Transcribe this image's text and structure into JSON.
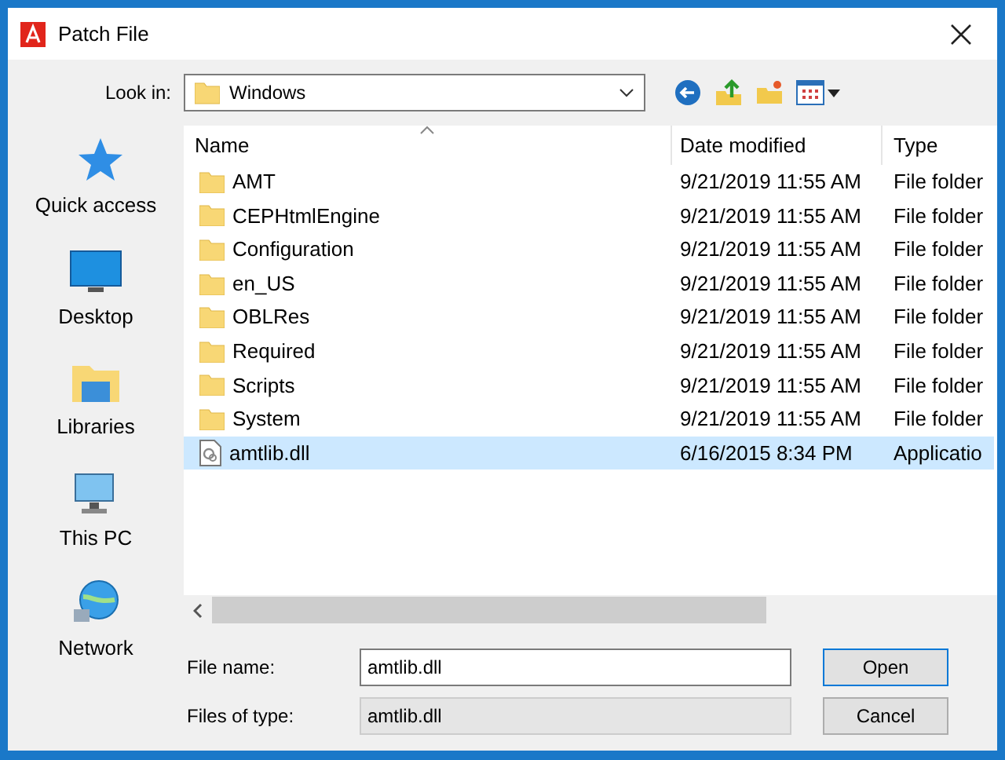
{
  "window": {
    "title": "Patch File"
  },
  "look_in": {
    "label": "Look in:",
    "value": "Windows"
  },
  "places": [
    {
      "kind": "quick",
      "label": "Quick access"
    },
    {
      "kind": "desktop",
      "label": "Desktop"
    },
    {
      "kind": "libraries",
      "label": "Libraries"
    },
    {
      "kind": "pc",
      "label": "This PC"
    },
    {
      "kind": "network",
      "label": "Network"
    }
  ],
  "table": {
    "columns": [
      "Name",
      "Date modified",
      "Type"
    ],
    "rows": [
      {
        "kind": "folder",
        "name": "AMT",
        "date": "9/21/2019 11:55 AM",
        "type": "File folder",
        "selected": false
      },
      {
        "kind": "folder",
        "name": "CEPHtmlEngine",
        "date": "9/21/2019 11:55 AM",
        "type": "File folder",
        "selected": false
      },
      {
        "kind": "folder",
        "name": "Configuration",
        "date": "9/21/2019 11:55 AM",
        "type": "File folder",
        "selected": false
      },
      {
        "kind": "folder",
        "name": "en_US",
        "date": "9/21/2019 11:55 AM",
        "type": "File folder",
        "selected": false
      },
      {
        "kind": "folder",
        "name": "OBLRes",
        "date": "9/21/2019 11:55 AM",
        "type": "File folder",
        "selected": false
      },
      {
        "kind": "folder",
        "name": "Required",
        "date": "9/21/2019 11:55 AM",
        "type": "File folder",
        "selected": false
      },
      {
        "kind": "folder",
        "name": "Scripts",
        "date": "9/21/2019 11:55 AM",
        "type": "File folder",
        "selected": false
      },
      {
        "kind": "folder",
        "name": "System",
        "date": "9/21/2019 11:55 AM",
        "type": "File folder",
        "selected": false
      },
      {
        "kind": "file",
        "name": "amtlib.dll",
        "date": "6/16/2015 8:34 PM",
        "type": "Applicatio",
        "selected": true
      }
    ]
  },
  "file_name": {
    "label": "File name:",
    "value": "amtlib.dll"
  },
  "file_type": {
    "label": "Files of type:",
    "value": "amtlib.dll"
  },
  "buttons": [
    "Open",
    "Cancel"
  ]
}
